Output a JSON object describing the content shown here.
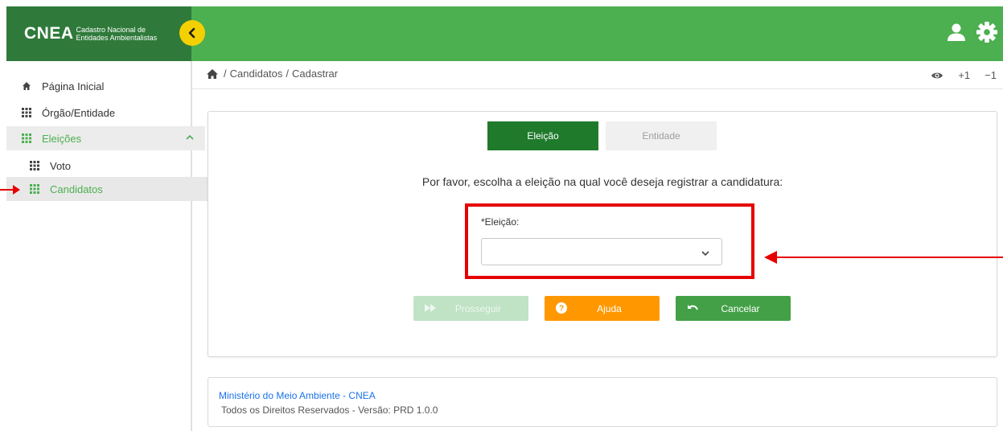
{
  "brand": {
    "logo_text": "CNEA",
    "subtitle_line1": "Cadastro Nacional de",
    "subtitle_line2": "Entidades Ambientalistas"
  },
  "colors": {
    "brand_dark_green": "#2f7a3a",
    "topbar_green": "#4caf50",
    "active_step": "#1f7a2c",
    "yellow_toggle": "#f5d000",
    "warning_orange": "#ff9800",
    "cancel_green": "#43a047",
    "highlight_red": "#e60000",
    "link_blue": "#1a73e8"
  },
  "header": {
    "icons": [
      "user-icon",
      "gear-icon"
    ],
    "collapse_icon": "chevron-left-icon"
  },
  "sidebar": {
    "items": [
      {
        "label": "Página Inicial",
        "icon": "home-icon"
      },
      {
        "label": "Órgão/Entidade",
        "icon": "grid-icon"
      },
      {
        "label": "Eleições",
        "icon": "grid-icon",
        "expanded": true
      },
      {
        "label": "Voto",
        "icon": "grid-icon"
      },
      {
        "label": "Candidatos",
        "icon": "grid-icon",
        "selected": true
      }
    ]
  },
  "breadcrumb": {
    "separator": "/",
    "items": [
      "Candidatos",
      "Cadastrar"
    ]
  },
  "toolbar": {
    "font_increase": "+1",
    "font_decrease": "−1",
    "icons": [
      "eye-icon"
    ]
  },
  "wizard": {
    "steps": [
      {
        "label": "Eleição",
        "active": true
      },
      {
        "label": "Entidade",
        "active": false
      }
    ],
    "prompt": "Por favor, escolha a eleição na qual você deseja registrar a candidatura:",
    "field_label": "*Eleição:",
    "field_value": "",
    "buttons": {
      "prosseguir": "Prosseguir",
      "ajuda": "Ajuda",
      "cancelar": "Cancelar"
    }
  },
  "footer": {
    "link": "Ministério do Meio Ambiente - CNEA",
    "text": "Todos os Direitos Reservados - Versão: PRD 1.0.0"
  }
}
